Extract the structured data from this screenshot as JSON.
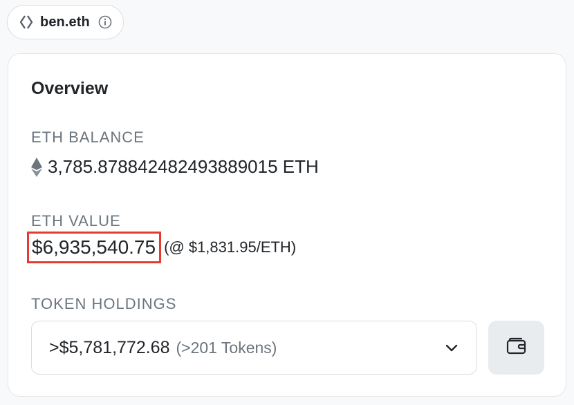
{
  "ens": {
    "name": "ben.eth",
    "icon": "ens-logo-icon",
    "info_icon": "info-icon"
  },
  "overview": {
    "title": "Overview",
    "eth_balance": {
      "label": "ETH BALANCE",
      "value": "3,785.878842482493889015 ETH",
      "icon": "ethereum-icon"
    },
    "eth_value": {
      "label": "ETH VALUE",
      "value": "$6,935,540.75",
      "rate": "(@ $1,831.95/ETH)",
      "highlight_color": "#e53a2e"
    },
    "token_holdings": {
      "label": "TOKEN HOLDINGS",
      "total": ">$5,781,772.68",
      "count": "(>201 Tokens)",
      "dropdown_icon": "chevron-down-icon",
      "wallet_icon": "wallet-icon"
    }
  }
}
